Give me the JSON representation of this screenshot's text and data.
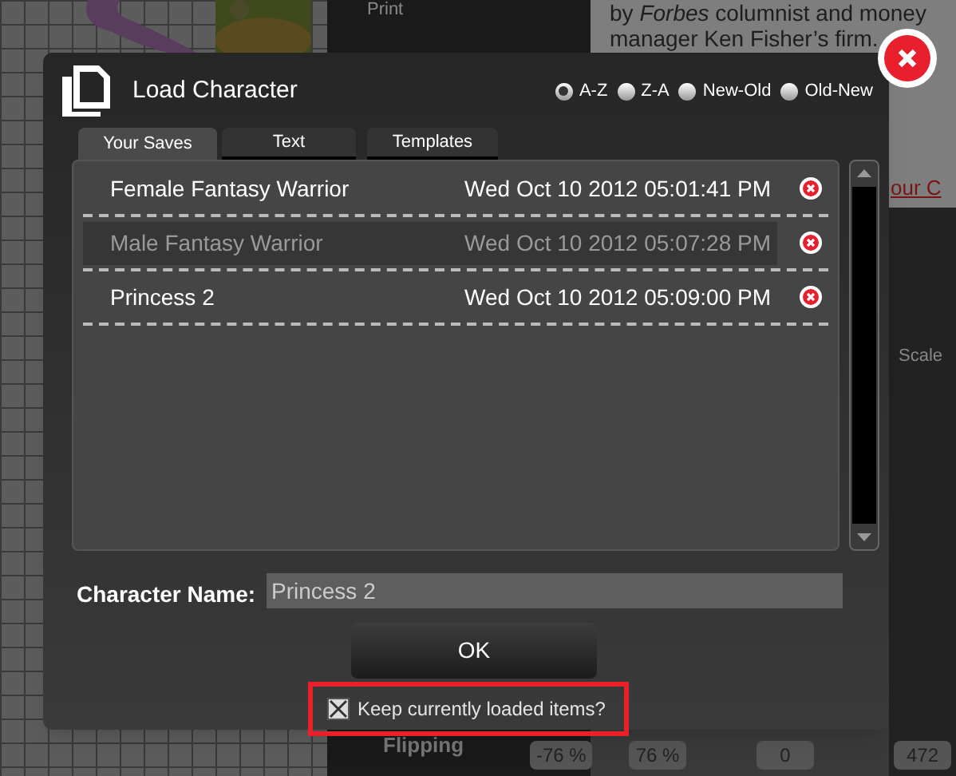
{
  "background": {
    "print_label": "Print",
    "article_lines": [
      "by *Forbes* columnist and money",
      "manager Ken Fisher’s firm."
    ],
    "link_fragment": "our C",
    "scale_label": "Scale",
    "flipping_label": "Flipping",
    "fields": [
      "-76 %",
      "76 %",
      "0",
      "472"
    ]
  },
  "dialog": {
    "title": "Load Character",
    "sort_options": [
      {
        "label": "A-Z",
        "selected": true
      },
      {
        "label": "Z-A",
        "selected": false
      },
      {
        "label": "New-Old",
        "selected": false
      },
      {
        "label": "Old-New",
        "selected": false
      }
    ],
    "tabs": [
      {
        "label": "Your Saves",
        "selected": true
      },
      {
        "label": "Text",
        "selected": false
      },
      {
        "label": "Templates",
        "selected": false
      }
    ],
    "saves": [
      {
        "name": "Female Fantasy Warrior",
        "date": "Wed Oct 10 2012 05:01:41 PM",
        "selected": false
      },
      {
        "name": "Male Fantasy Warrior",
        "date": "Wed Oct 10 2012 05:07:28 PM",
        "selected": true
      },
      {
        "name": "Princess 2",
        "date": "Wed Oct 10 2012 05:09:00 PM",
        "selected": false
      }
    ],
    "name_label": "Character Name:",
    "name_value": "Princess 2",
    "ok_button": "OK",
    "keep_items": {
      "label": "Keep currently loaded items?",
      "checked": true
    }
  }
}
